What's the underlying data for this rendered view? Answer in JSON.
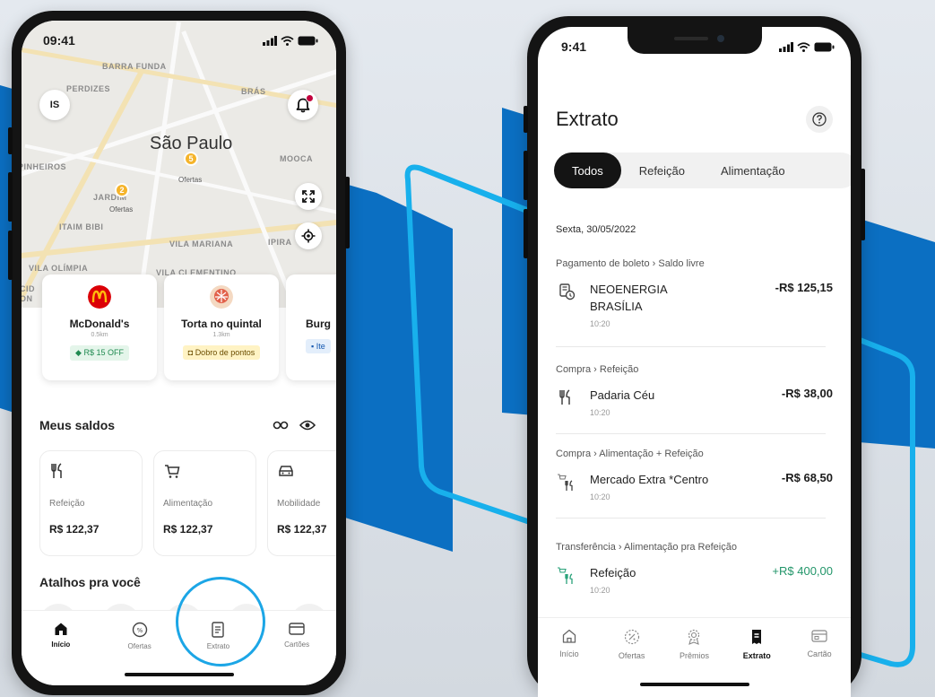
{
  "phone_left": {
    "status": {
      "time": "09:41"
    },
    "map": {
      "labels": [
        "BARRA FUNDA",
        "PERDIZES",
        "BRÁS",
        "PINHEIROS",
        "JARDIM",
        "MOOCA",
        "ITAIM BIBI",
        "VILA MARIANA",
        "IPIRA",
        "VILA OLÍMPIA",
        "VILA CLEMENTINO",
        "CID",
        "ON"
      ],
      "city": "São Paulo",
      "clusters": [
        {
          "count": "5",
          "label": "Ofertas"
        },
        {
          "count": "2",
          "label": "Ofertas"
        }
      ],
      "avatar_initials": "IS"
    },
    "stores": [
      {
        "name": "McDonald's",
        "distance": "0.5km",
        "badge": "R$ 15 OFF"
      },
      {
        "name": "Torta no quintal",
        "distance": "1.3km",
        "badge": "Dobro de pontos"
      },
      {
        "name": "Burg",
        "distance": "",
        "badge": "Ite"
      }
    ],
    "balances": {
      "title": "Meus saldos",
      "items": [
        {
          "label": "Refeição",
          "value": "R$ 122,37"
        },
        {
          "label": "Alimentação",
          "value": "R$ 122,37"
        },
        {
          "label": "Mobilidade",
          "value": "R$ 122,37"
        }
      ]
    },
    "shortcuts_title": "Atalhos pra você",
    "tabs": [
      "Início",
      "Ofertas",
      "Extrato",
      "Cartões"
    ]
  },
  "phone_right": {
    "status": {
      "time": "9:41"
    },
    "title": "Extrato",
    "filters": [
      "Todos",
      "Refeição",
      "Alimentação"
    ],
    "date": "Sexta, 30/05/2022",
    "transactions": [
      {
        "category": "Pagamento de boleto › Saldo livre",
        "name_line1": "NEOENERGIA",
        "name_line2": "BRASÍLIA",
        "time": "10:20",
        "amount": "-R$ 125,15"
      },
      {
        "category": "Compra › Refeição",
        "name_line1": "Padaria Céu",
        "time": "10:20",
        "amount": "-R$ 38,00"
      },
      {
        "category": "Compra › Alimentação + Refeição",
        "name_line1": "Mercado Extra *Centro",
        "time": "10:20",
        "amount": "-R$ 68,50"
      },
      {
        "category": "Transferência › Alimentação pra Refeição",
        "name_line1": "Refeição",
        "time": "10:20",
        "amount": "+R$ 400,00"
      }
    ],
    "tabs": [
      "Início",
      "Ofertas",
      "Prêmios",
      "Extrato",
      "Cartão"
    ]
  },
  "colors": {
    "brand_blue": "#0b6fc2",
    "outline_cyan": "#18b0ec",
    "positive_green": "#23966a"
  }
}
